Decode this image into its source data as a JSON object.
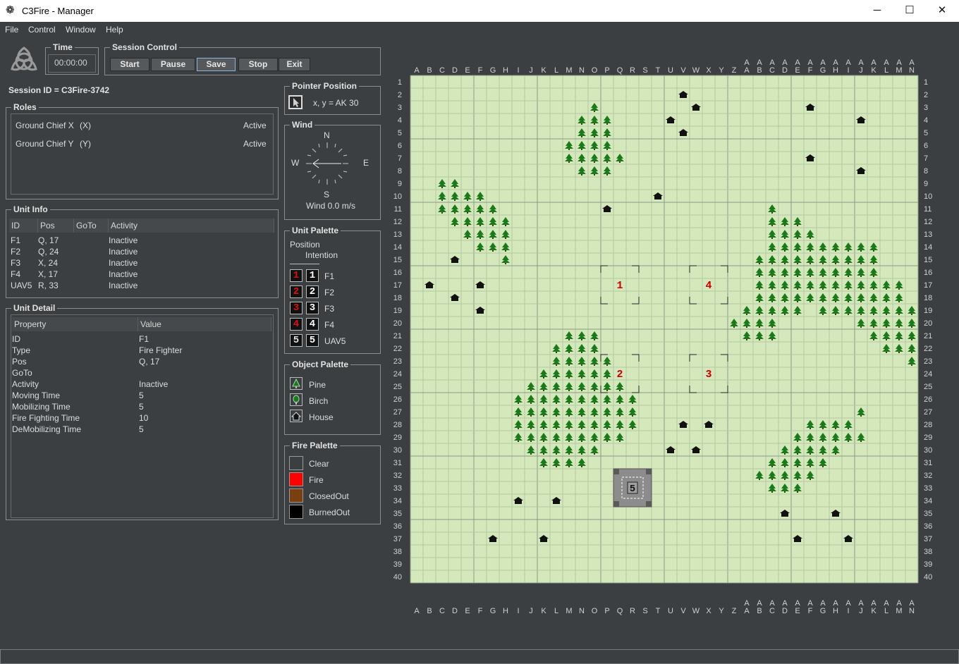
{
  "window": {
    "title": "C3Fire - Manager",
    "app_icon": "celtic-knot-icon",
    "minimize": "─",
    "maximize": "☐",
    "close": "✕"
  },
  "menu": [
    "File",
    "Control",
    "Window",
    "Help"
  ],
  "time": {
    "title": "Time",
    "value": "00:00:00"
  },
  "session_control": {
    "title": "Session Control",
    "buttons": [
      "Start",
      "Pause",
      "Save",
      "Stop",
      "Exit"
    ],
    "active": "Save"
  },
  "session_id": "Session ID = C3Fire-3742",
  "roles": {
    "title": "Roles",
    "items": [
      {
        "name": "Ground Chief X",
        "code": "(X)",
        "status": "Active"
      },
      {
        "name": "Ground Chief Y",
        "code": "(Y)",
        "status": "Active"
      }
    ]
  },
  "unit_info": {
    "title": "Unit Info",
    "columns": [
      "ID",
      "Pos",
      "GoTo",
      "Activity"
    ],
    "rows": [
      [
        "F1",
        "Q, 17",
        "",
        "Inactive"
      ],
      [
        "F2",
        "Q, 24",
        "",
        "Inactive"
      ],
      [
        "F3",
        "X, 24",
        "",
        "Inactive"
      ],
      [
        "F4",
        "X, 17",
        "",
        "Inactive"
      ],
      [
        "UAV5",
        "R, 33",
        "",
        "Inactive"
      ]
    ]
  },
  "unit_detail": {
    "title": "Unit Detail",
    "columns": [
      "Property",
      "Value"
    ],
    "rows": [
      [
        "ID",
        "F1"
      ],
      [
        "Type",
        "Fire Fighter"
      ],
      [
        "Pos",
        "Q, 17"
      ],
      [
        "GoTo",
        ""
      ],
      [
        "Activity",
        "Inactive"
      ],
      [
        "Moving Time",
        "5"
      ],
      [
        "Mobilizing Time",
        "5"
      ],
      [
        "Fire Fighting Time",
        "10"
      ],
      [
        "DeMobilizing Time",
        "5"
      ]
    ]
  },
  "pointer_position": {
    "title": "Pointer Position",
    "text": "x, y =  AK 30",
    "icon": "cursor-arrow-icon"
  },
  "wind": {
    "title": "Wind",
    "n": "N",
    "s": "S",
    "w": "W",
    "e": "E",
    "text": "Wind 0.0 m/s"
  },
  "unit_palette": {
    "title": "Unit Palette",
    "position_label": "Position",
    "intention_label": "Intention",
    "items": [
      {
        "num": "1",
        "label": "F1"
      },
      {
        "num": "2",
        "label": "F2"
      },
      {
        "num": "3",
        "label": "F3"
      },
      {
        "num": "4",
        "label": "F4"
      },
      {
        "num": "5",
        "label": "UAV5"
      }
    ]
  },
  "object_palette": {
    "title": "Object Palette",
    "items": [
      {
        "label": "Pine",
        "icon": "pine-icon"
      },
      {
        "label": "Birch",
        "icon": "birch-icon"
      },
      {
        "label": "House",
        "icon": "house-icon"
      }
    ]
  },
  "fire_palette": {
    "title": "Fire Palette",
    "items": [
      {
        "label": "Clear",
        "color": "#3c3f41"
      },
      {
        "label": "Fire",
        "color": "#ff0000"
      },
      {
        "label": "ClosedOut",
        "color": "#7a3f0f"
      },
      {
        "label": "BurnedOut",
        "color": "#000000"
      }
    ]
  },
  "map": {
    "columns": [
      "A",
      "B",
      "C",
      "D",
      "E",
      "F",
      "G",
      "H",
      "I",
      "J",
      "K",
      "L",
      "M",
      "N",
      "O",
      "P",
      "Q",
      "R",
      "S",
      "T",
      "U",
      "V",
      "W",
      "X",
      "Y",
      "Z",
      "AA",
      "AB",
      "AC",
      "AD",
      "AE",
      "AF",
      "AG",
      "AH",
      "AI",
      "AJ",
      "AK",
      "AL",
      "AM",
      "AN"
    ],
    "rows": 40,
    "colors": {
      "grass": "#d4e8bc",
      "grid": "#b4c8a4",
      "major": "#8c9a88",
      "pine": "#1a7a1a",
      "house": "#111111",
      "unit_red": "#cc0000"
    },
    "pines": [
      [
        14,
        3
      ],
      [
        13,
        4
      ],
      [
        14,
        4
      ],
      [
        15,
        4
      ],
      [
        13,
        5
      ],
      [
        14,
        5
      ],
      [
        15,
        5
      ],
      [
        12,
        6
      ],
      [
        13,
        6
      ],
      [
        14,
        6
      ],
      [
        15,
        6
      ],
      [
        12,
        7
      ],
      [
        13,
        7
      ],
      [
        14,
        7
      ],
      [
        15,
        7
      ],
      [
        16,
        7
      ],
      [
        13,
        8
      ],
      [
        14,
        8
      ],
      [
        15,
        8
      ],
      [
        2,
        9
      ],
      [
        3,
        9
      ],
      [
        2,
        10
      ],
      [
        3,
        10
      ],
      [
        4,
        10
      ],
      [
        5,
        10
      ],
      [
        2,
        11
      ],
      [
        3,
        11
      ],
      [
        4,
        11
      ],
      [
        5,
        11
      ],
      [
        6,
        11
      ],
      [
        3,
        12
      ],
      [
        4,
        12
      ],
      [
        5,
        12
      ],
      [
        6,
        12
      ],
      [
        7,
        12
      ],
      [
        4,
        13
      ],
      [
        5,
        13
      ],
      [
        6,
        13
      ],
      [
        7,
        13
      ],
      [
        5,
        14
      ],
      [
        6,
        14
      ],
      [
        7,
        14
      ],
      [
        7,
        15
      ],
      [
        28,
        11
      ],
      [
        28,
        12
      ],
      [
        29,
        12
      ],
      [
        30,
        12
      ],
      [
        28,
        13
      ],
      [
        29,
        13
      ],
      [
        30,
        13
      ],
      [
        31,
        13
      ],
      [
        28,
        14
      ],
      [
        29,
        14
      ],
      [
        30,
        14
      ],
      [
        31,
        14
      ],
      [
        32,
        14
      ],
      [
        33,
        14
      ],
      [
        34,
        14
      ],
      [
        35,
        14
      ],
      [
        36,
        14
      ],
      [
        27,
        15
      ],
      [
        28,
        15
      ],
      [
        29,
        15
      ],
      [
        30,
        15
      ],
      [
        31,
        15
      ],
      [
        32,
        15
      ],
      [
        33,
        15
      ],
      [
        34,
        15
      ],
      [
        35,
        15
      ],
      [
        36,
        15
      ],
      [
        27,
        16
      ],
      [
        28,
        16
      ],
      [
        29,
        16
      ],
      [
        30,
        16
      ],
      [
        31,
        16
      ],
      [
        32,
        16
      ],
      [
        33,
        16
      ],
      [
        34,
        16
      ],
      [
        35,
        16
      ],
      [
        36,
        16
      ],
      [
        27,
        17
      ],
      [
        28,
        17
      ],
      [
        29,
        17
      ],
      [
        30,
        17
      ],
      [
        31,
        17
      ],
      [
        32,
        17
      ],
      [
        33,
        17
      ],
      [
        34,
        17
      ],
      [
        35,
        17
      ],
      [
        36,
        17
      ],
      [
        37,
        17
      ],
      [
        38,
        17
      ],
      [
        27,
        18
      ],
      [
        28,
        18
      ],
      [
        29,
        18
      ],
      [
        30,
        18
      ],
      [
        31,
        18
      ],
      [
        32,
        18
      ],
      [
        33,
        18
      ],
      [
        34,
        18
      ],
      [
        35,
        18
      ],
      [
        36,
        18
      ],
      [
        37,
        18
      ],
      [
        38,
        18
      ],
      [
        26,
        19
      ],
      [
        27,
        19
      ],
      [
        28,
        19
      ],
      [
        29,
        19
      ],
      [
        30,
        19
      ],
      [
        32,
        19
      ],
      [
        33,
        19
      ],
      [
        34,
        19
      ],
      [
        35,
        19
      ],
      [
        36,
        19
      ],
      [
        37,
        19
      ],
      [
        38,
        19
      ],
      [
        39,
        19
      ],
      [
        25,
        20
      ],
      [
        26,
        20
      ],
      [
        27,
        20
      ],
      [
        28,
        20
      ],
      [
        35,
        20
      ],
      [
        36,
        20
      ],
      [
        37,
        20
      ],
      [
        38,
        20
      ],
      [
        39,
        20
      ],
      [
        26,
        21
      ],
      [
        27,
        21
      ],
      [
        28,
        21
      ],
      [
        36,
        21
      ],
      [
        37,
        21
      ],
      [
        38,
        21
      ],
      [
        39,
        21
      ],
      [
        37,
        22
      ],
      [
        38,
        22
      ],
      [
        39,
        22
      ],
      [
        39,
        23
      ],
      [
        12,
        21
      ],
      [
        13,
        21
      ],
      [
        14,
        21
      ],
      [
        11,
        22
      ],
      [
        12,
        22
      ],
      [
        13,
        22
      ],
      [
        14,
        22
      ],
      [
        11,
        23
      ],
      [
        12,
        23
      ],
      [
        13,
        23
      ],
      [
        14,
        23
      ],
      [
        15,
        23
      ],
      [
        10,
        24
      ],
      [
        11,
        24
      ],
      [
        12,
        24
      ],
      [
        13,
        24
      ],
      [
        14,
        24
      ],
      [
        15,
        24
      ],
      [
        9,
        25
      ],
      [
        10,
        25
      ],
      [
        11,
        25
      ],
      [
        12,
        25
      ],
      [
        13,
        25
      ],
      [
        14,
        25
      ],
      [
        15,
        25
      ],
      [
        16,
        25
      ],
      [
        8,
        26
      ],
      [
        9,
        26
      ],
      [
        10,
        26
      ],
      [
        11,
        26
      ],
      [
        12,
        26
      ],
      [
        13,
        26
      ],
      [
        14,
        26
      ],
      [
        15,
        26
      ],
      [
        16,
        26
      ],
      [
        17,
        26
      ],
      [
        8,
        27
      ],
      [
        9,
        27
      ],
      [
        10,
        27
      ],
      [
        11,
        27
      ],
      [
        12,
        27
      ],
      [
        13,
        27
      ],
      [
        14,
        27
      ],
      [
        15,
        27
      ],
      [
        16,
        27
      ],
      [
        17,
        27
      ],
      [
        8,
        28
      ],
      [
        9,
        28
      ],
      [
        10,
        28
      ],
      [
        11,
        28
      ],
      [
        12,
        28
      ],
      [
        13,
        28
      ],
      [
        14,
        28
      ],
      [
        15,
        28
      ],
      [
        16,
        28
      ],
      [
        17,
        28
      ],
      [
        8,
        29
      ],
      [
        9,
        29
      ],
      [
        10,
        29
      ],
      [
        11,
        29
      ],
      [
        12,
        29
      ],
      [
        13,
        29
      ],
      [
        14,
        29
      ],
      [
        15,
        29
      ],
      [
        16,
        29
      ],
      [
        9,
        30
      ],
      [
        10,
        30
      ],
      [
        11,
        30
      ],
      [
        12,
        30
      ],
      [
        13,
        30
      ],
      [
        14,
        30
      ],
      [
        10,
        31
      ],
      [
        11,
        31
      ],
      [
        12,
        31
      ],
      [
        13,
        31
      ],
      [
        35,
        27
      ],
      [
        31,
        28
      ],
      [
        32,
        28
      ],
      [
        33,
        28
      ],
      [
        34,
        28
      ],
      [
        30,
        29
      ],
      [
        31,
        29
      ],
      [
        32,
        29
      ],
      [
        33,
        29
      ],
      [
        34,
        29
      ],
      [
        35,
        29
      ],
      [
        29,
        30
      ],
      [
        30,
        30
      ],
      [
        31,
        30
      ],
      [
        32,
        30
      ],
      [
        33,
        30
      ],
      [
        28,
        31
      ],
      [
        29,
        31
      ],
      [
        30,
        31
      ],
      [
        31,
        31
      ],
      [
        32,
        31
      ],
      [
        27,
        32
      ],
      [
        28,
        32
      ],
      [
        29,
        32
      ],
      [
        30,
        32
      ],
      [
        31,
        32
      ],
      [
        28,
        33
      ],
      [
        29,
        33
      ],
      [
        30,
        33
      ]
    ],
    "houses": [
      [
        21,
        2
      ],
      [
        22,
        3
      ],
      [
        20,
        4
      ],
      [
        21,
        5
      ],
      [
        31,
        3
      ],
      [
        35,
        4
      ],
      [
        31,
        7
      ],
      [
        35,
        8
      ],
      [
        19,
        10
      ],
      [
        15,
        11
      ],
      [
        3,
        15
      ],
      [
        1,
        17
      ],
      [
        5,
        17
      ],
      [
        3,
        18
      ],
      [
        5,
        19
      ],
      [
        21,
        28
      ],
      [
        23,
        28
      ],
      [
        20,
        30
      ],
      [
        22,
        30
      ],
      [
        8,
        34
      ],
      [
        11,
        34
      ],
      [
        29,
        35
      ],
      [
        33,
        35
      ],
      [
        6,
        37
      ],
      [
        10,
        37
      ],
      [
        30,
        37
      ],
      [
        34,
        37
      ]
    ],
    "units": [
      {
        "num": "1",
        "col": 16,
        "row": 17
      },
      {
        "num": "2",
        "col": 16,
        "row": 24
      },
      {
        "num": "3",
        "col": 23,
        "row": 24
      },
      {
        "num": "4",
        "col": 23,
        "row": 17
      }
    ],
    "uav": {
      "num": "5",
      "col": 17,
      "row": 33
    }
  }
}
